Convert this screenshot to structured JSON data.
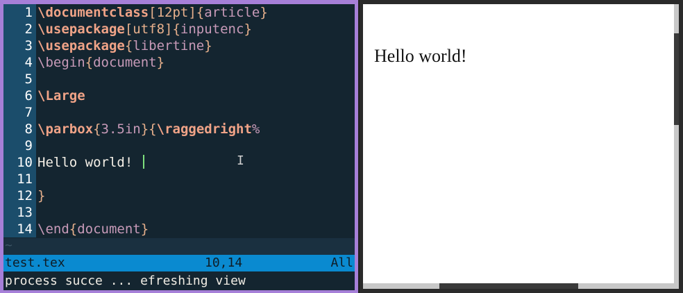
{
  "editor": {
    "lines": [
      {
        "n": "1",
        "parts": [
          [
            "kw",
            "\\documentclass"
          ],
          [
            "bk",
            "[12pt]{"
          ],
          [
            "arg",
            "article"
          ],
          [
            "bk",
            "}"
          ]
        ]
      },
      {
        "n": "2",
        "parts": [
          [
            "kw",
            "\\usepackage"
          ],
          [
            "bk",
            "[utf8]{"
          ],
          [
            "arg",
            "inputenc"
          ],
          [
            "bk",
            "}"
          ]
        ]
      },
      {
        "n": "3",
        "parts": [
          [
            "kw",
            "\\usepackage"
          ],
          [
            "bk",
            "{"
          ],
          [
            "arg",
            "libertine"
          ],
          [
            "bk",
            "}"
          ]
        ]
      },
      {
        "n": "4",
        "parts": [
          [
            "cmd-plain",
            "\\begin"
          ],
          [
            "bk",
            "{"
          ],
          [
            "arg",
            "document"
          ],
          [
            "bk",
            "}"
          ]
        ]
      },
      {
        "n": "5",
        "parts": []
      },
      {
        "n": "6",
        "parts": [
          [
            "kw",
            "\\Large"
          ]
        ]
      },
      {
        "n": "7",
        "parts": []
      },
      {
        "n": "8",
        "parts": [
          [
            "kw",
            "\\parbox"
          ],
          [
            "bk",
            "{"
          ],
          [
            "arg",
            "3.5in"
          ],
          [
            "bk",
            "}{"
          ],
          [
            "kw",
            "\\raggedright"
          ],
          [
            "arg",
            "%"
          ]
        ]
      },
      {
        "n": "9",
        "parts": []
      },
      {
        "n": "10",
        "parts": [
          [
            "txt",
            "Hello world! "
          ]
        ],
        "cursor": true
      },
      {
        "n": "11",
        "parts": []
      },
      {
        "n": "12",
        "parts": [
          [
            "bk",
            "}"
          ]
        ]
      },
      {
        "n": "13",
        "parts": []
      },
      {
        "n": "14",
        "parts": [
          [
            "cmd-plain",
            "\\end"
          ],
          [
            "bk",
            "{"
          ],
          [
            "arg",
            "document"
          ],
          [
            "bk",
            "}"
          ]
        ]
      }
    ],
    "tilde": "~",
    "status": {
      "filename": "test.tex",
      "position": "10,14",
      "scroll": "All"
    },
    "message": "process succe ... efreshing view"
  },
  "preview": {
    "text": "Hello world!"
  },
  "colors": {
    "pane_border": "#a67fd8",
    "editor_bg": "#142530",
    "gutter_bg": "#1b4d6b",
    "statusline_bg": "#0a8ad0",
    "keyword": "#f0a387",
    "cursor": "#7de07d"
  }
}
